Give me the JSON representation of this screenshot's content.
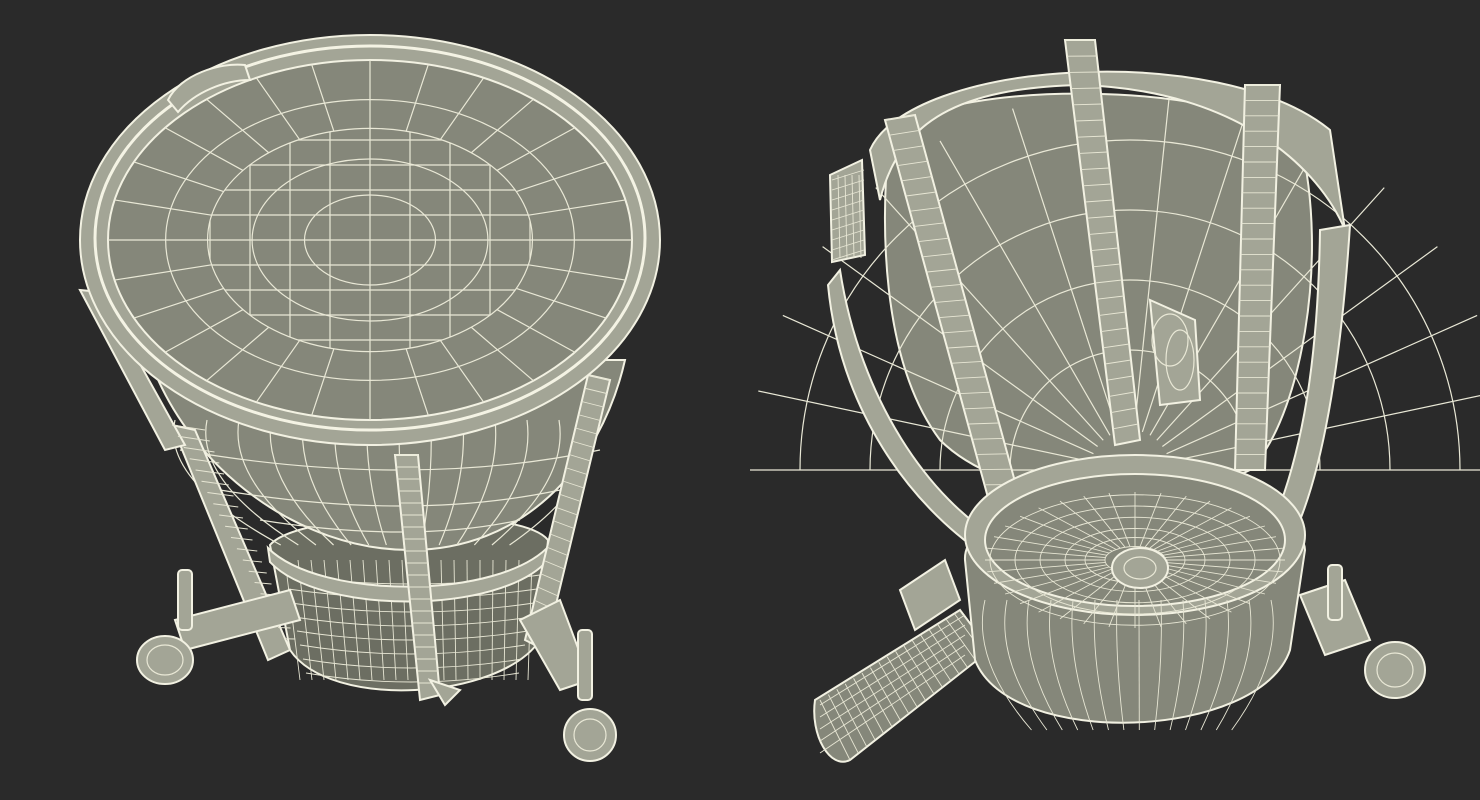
{
  "scene": {
    "background": "#2a2a2a",
    "mesh_color": "#ecebd9",
    "surface_color": "#85877a",
    "views": [
      {
        "name": "top-three-quarter-view"
      },
      {
        "name": "bottom-three-quarter-view"
      }
    ]
  }
}
